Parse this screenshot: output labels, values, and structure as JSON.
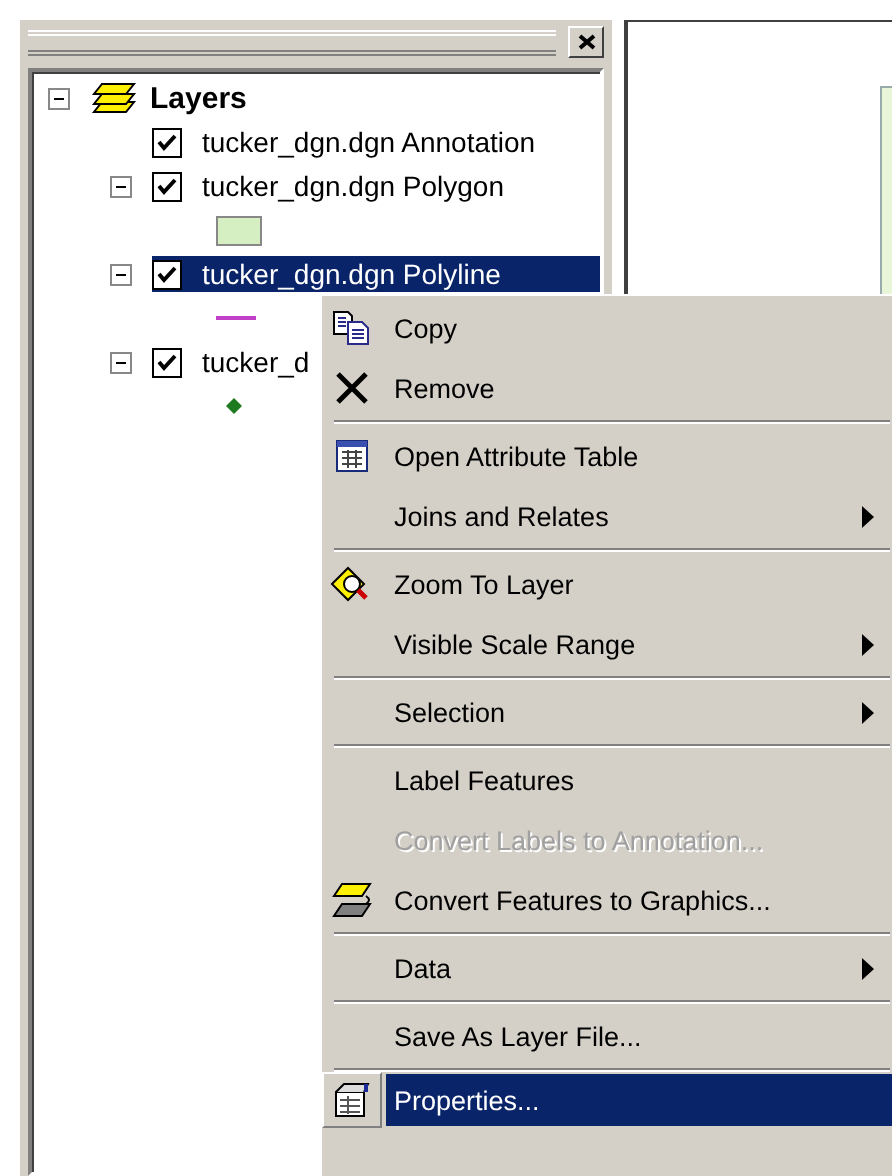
{
  "toc": {
    "root": {
      "label": "Layers",
      "expanded": true,
      "children": [
        {
          "label": "tucker_dgn.dgn Annotation",
          "kind": "annotation",
          "checked": true,
          "selected": false
        },
        {
          "label": "tucker_dgn.dgn Polygon",
          "kind": "polygon",
          "checked": true,
          "selected": false,
          "color": "#d6efc2"
        },
        {
          "label": "tucker_dgn.dgn Polyline",
          "kind": "polyline",
          "checked": true,
          "selected": true,
          "color": "#c040c8"
        },
        {
          "label": "tucker_d",
          "kind": "point",
          "checked": true,
          "selected": false,
          "color": "#1e7a1e"
        }
      ]
    }
  },
  "context_menu": {
    "items": [
      {
        "kind": "item",
        "label": "Copy",
        "submenu": false,
        "disabled": false,
        "selected": false
      },
      {
        "kind": "item",
        "label": "Remove",
        "submenu": false,
        "disabled": false,
        "selected": false
      },
      {
        "kind": "separator"
      },
      {
        "kind": "item",
        "label": "Open Attribute Table",
        "submenu": false,
        "disabled": false,
        "selected": false
      },
      {
        "kind": "item",
        "label": "Joins and Relates",
        "submenu": true,
        "disabled": false,
        "selected": false
      },
      {
        "kind": "separator"
      },
      {
        "kind": "item",
        "label": "Zoom To Layer",
        "submenu": false,
        "disabled": false,
        "selected": false
      },
      {
        "kind": "item",
        "label": "Visible Scale Range",
        "submenu": true,
        "disabled": false,
        "selected": false
      },
      {
        "kind": "separator"
      },
      {
        "kind": "item",
        "label": "Selection",
        "submenu": true,
        "disabled": false,
        "selected": false
      },
      {
        "kind": "separator"
      },
      {
        "kind": "item",
        "label": "Label Features",
        "submenu": false,
        "disabled": false,
        "selected": false
      },
      {
        "kind": "item",
        "label": "Convert Labels to Annotation...",
        "submenu": false,
        "disabled": true,
        "selected": false
      },
      {
        "kind": "item",
        "label": "Convert Features to Graphics...",
        "submenu": false,
        "disabled": false,
        "selected": false
      },
      {
        "kind": "separator"
      },
      {
        "kind": "item",
        "label": "Data",
        "submenu": true,
        "disabled": false,
        "selected": false
      },
      {
        "kind": "separator"
      },
      {
        "kind": "item",
        "label": "Save As Layer File...",
        "submenu": false,
        "disabled": false,
        "selected": false
      },
      {
        "kind": "separator"
      },
      {
        "kind": "item",
        "label": "Properties...",
        "submenu": false,
        "disabled": false,
        "selected": true
      }
    ]
  }
}
